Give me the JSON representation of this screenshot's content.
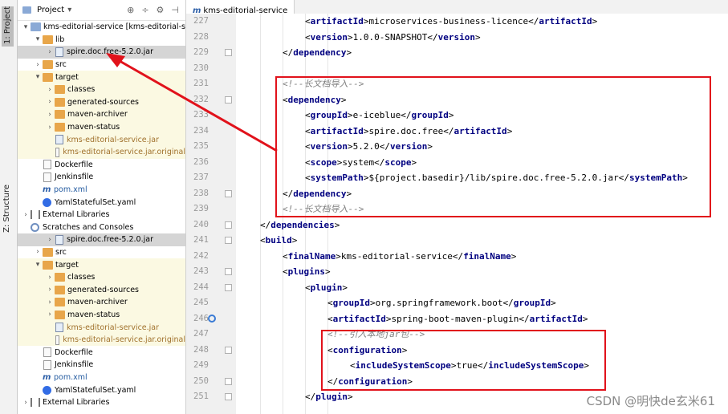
{
  "toolstrip": {
    "project_tab": "1: Project",
    "structure_tab": "Z: Structure"
  },
  "project_panel": {
    "title": "Project",
    "dropdown": "▾",
    "tools": [
      "⊕",
      "÷",
      "⚙",
      "⊣"
    ],
    "tree": [
      {
        "label": "kms-editorial-service [kms-editorial-servi",
        "arrow": "▾",
        "icon": "folder-blue",
        "indent": 0
      },
      {
        "label": "lib",
        "arrow": "▾",
        "icon": "folder",
        "indent": 1
      },
      {
        "label": "spire.doc.free-5.2.0.jar",
        "arrow": "›",
        "icon": "jar",
        "indent": 2,
        "sel": true
      },
      {
        "label": "src",
        "arrow": "›",
        "icon": "folder",
        "indent": 1
      },
      {
        "label": "target",
        "arrow": "▾",
        "icon": "folder",
        "indent": 1,
        "yellow": true
      },
      {
        "label": "classes",
        "arrow": "›",
        "icon": "folder",
        "indent": 2,
        "yellow": true
      },
      {
        "label": "generated-sources",
        "arrow": "›",
        "icon": "folder",
        "indent": 2,
        "yellow": true
      },
      {
        "label": "maven-archiver",
        "arrow": "›",
        "icon": "folder",
        "indent": 2,
        "yellow": true
      },
      {
        "label": "maven-status",
        "arrow": "›",
        "icon": "folder",
        "indent": 2,
        "yellow": true
      },
      {
        "label": "kms-editorial-service.jar",
        "arrow": "",
        "icon": "jar",
        "indent": 2,
        "yellow": true,
        "color": "orange"
      },
      {
        "label": "kms-editorial-service.jar.original",
        "arrow": "",
        "icon": "file",
        "indent": 2,
        "yellow": true,
        "color": "orange"
      },
      {
        "label": "Dockerfile",
        "arrow": "",
        "icon": "file",
        "indent": 1
      },
      {
        "label": "Jenkinsfile",
        "arrow": "",
        "icon": "file",
        "indent": 1
      },
      {
        "label": "pom.xml",
        "arrow": "",
        "icon": "m",
        "indent": 1,
        "color": "blue"
      },
      {
        "label": "YamlStatefulSet.yaml",
        "arrow": "",
        "icon": "k8s",
        "indent": 1
      },
      {
        "label": "External Libraries",
        "arrow": "›",
        "icon": "lib",
        "indent": 0
      },
      {
        "label": "Scratches and Consoles",
        "arrow": "",
        "icon": "scratch",
        "indent": 0
      },
      {
        "label": "spire.doc.free-5.2.0.jar",
        "arrow": "›",
        "icon": "jar",
        "indent": 2,
        "sel": true
      },
      {
        "label": "src",
        "arrow": "›",
        "icon": "folder",
        "indent": 1
      },
      {
        "label": "target",
        "arrow": "▾",
        "icon": "folder",
        "indent": 1,
        "yellow": true
      },
      {
        "label": "classes",
        "arrow": "›",
        "icon": "folder",
        "indent": 2,
        "yellow": true
      },
      {
        "label": "generated-sources",
        "arrow": "›",
        "icon": "folder",
        "indent": 2,
        "yellow": true
      },
      {
        "label": "maven-archiver",
        "arrow": "›",
        "icon": "folder",
        "indent": 2,
        "yellow": true
      },
      {
        "label": "maven-status",
        "arrow": "›",
        "icon": "folder",
        "indent": 2,
        "yellow": true
      },
      {
        "label": "kms-editorial-service.jar",
        "arrow": "",
        "icon": "jar",
        "indent": 2,
        "yellow": true,
        "color": "orange"
      },
      {
        "label": "kms-editorial-service.jar.original",
        "arrow": "",
        "icon": "file",
        "indent": 2,
        "yellow": true,
        "color": "orange"
      },
      {
        "label": "Dockerfile",
        "arrow": "",
        "icon": "file",
        "indent": 1
      },
      {
        "label": "Jenkinsfile",
        "arrow": "",
        "icon": "file",
        "indent": 1
      },
      {
        "label": "pom.xml",
        "arrow": "",
        "icon": "m",
        "indent": 1,
        "color": "blue"
      },
      {
        "label": "YamlStatefulSet.yaml",
        "arrow": "",
        "icon": "k8s",
        "indent": 1
      },
      {
        "label": "External Libraries",
        "arrow": "›",
        "icon": "lib",
        "indent": 0
      }
    ]
  },
  "editor": {
    "tab_icon": "m",
    "tab_label": "kms-editorial-service",
    "lines": [
      {
        "n": "227",
        "indent": 2,
        "parts": [
          [
            "br",
            "<"
          ],
          [
            "tag",
            "artifactId"
          ],
          [
            "br",
            ">microservices-business-licence</"
          ],
          [
            "tag",
            "artifactId"
          ],
          [
            "br",
            ">"
          ]
        ]
      },
      {
        "n": "228",
        "indent": 2,
        "parts": [
          [
            "br",
            "<"
          ],
          [
            "tag",
            "version"
          ],
          [
            "br",
            ">1.0.0-SNAPSHOT</"
          ],
          [
            "tag",
            "version"
          ],
          [
            "br",
            ">"
          ]
        ]
      },
      {
        "n": "229",
        "indent": 1,
        "fold": true,
        "parts": [
          [
            "br",
            "</"
          ],
          [
            "tag",
            "dependency"
          ],
          [
            "br",
            ">"
          ]
        ]
      },
      {
        "n": "230",
        "indent": 0,
        "parts": []
      },
      {
        "n": "231",
        "indent": 1,
        "parts": [
          [
            "cm",
            "<!--长文档导入-->"
          ]
        ]
      },
      {
        "n": "232",
        "indent": 1,
        "fold": true,
        "parts": [
          [
            "br",
            "<"
          ],
          [
            "tag",
            "dependency"
          ],
          [
            "br",
            ">"
          ]
        ]
      },
      {
        "n": "233",
        "indent": 2,
        "parts": [
          [
            "br",
            "<"
          ],
          [
            "tag",
            "groupId"
          ],
          [
            "br",
            ">e-iceblue</"
          ],
          [
            "tag",
            "groupId"
          ],
          [
            "br",
            ">"
          ]
        ]
      },
      {
        "n": "234",
        "indent": 2,
        "parts": [
          [
            "br",
            "<"
          ],
          [
            "tag",
            "artifactId"
          ],
          [
            "br",
            ">spire.doc.free</"
          ],
          [
            "tag",
            "artifactId"
          ],
          [
            "br",
            ">"
          ]
        ]
      },
      {
        "n": "235",
        "indent": 2,
        "parts": [
          [
            "br",
            "<"
          ],
          [
            "tag",
            "version"
          ],
          [
            "br",
            ">5.2.0</"
          ],
          [
            "tag",
            "version"
          ],
          [
            "br",
            ">"
          ]
        ]
      },
      {
        "n": "236",
        "indent": 2,
        "parts": [
          [
            "br",
            "<"
          ],
          [
            "tag",
            "scope"
          ],
          [
            "br",
            ">system</"
          ],
          [
            "tag",
            "scope"
          ],
          [
            "br",
            ">"
          ]
        ]
      },
      {
        "n": "237",
        "indent": 2,
        "parts": [
          [
            "br",
            "<"
          ],
          [
            "tag",
            "systemPath"
          ],
          [
            "br",
            ">${project.basedir}/lib/spire.doc.free-5.2.0.jar</"
          ],
          [
            "tag",
            "systemPath"
          ],
          [
            "br",
            ">"
          ]
        ]
      },
      {
        "n": "238",
        "indent": 1,
        "fold": true,
        "parts": [
          [
            "br",
            "</"
          ],
          [
            "tag",
            "dependency"
          ],
          [
            "br",
            ">"
          ]
        ]
      },
      {
        "n": "239",
        "indent": 1,
        "parts": [
          [
            "cm",
            "<!--长文档导入-->"
          ]
        ]
      },
      {
        "n": "240",
        "indent": 0,
        "fold": true,
        "parts": [
          [
            "br",
            "</"
          ],
          [
            "tag",
            "dependencies"
          ],
          [
            "br",
            ">"
          ]
        ]
      },
      {
        "n": "241",
        "indent": 0,
        "fold": true,
        "parts": [
          [
            "br",
            "<"
          ],
          [
            "tag",
            "build"
          ],
          [
            "br",
            ">"
          ]
        ]
      },
      {
        "n": "242",
        "indent": 1,
        "parts": [
          [
            "br",
            "<"
          ],
          [
            "tag",
            "finalName"
          ],
          [
            "br",
            ">kms-editorial-service</"
          ],
          [
            "tag",
            "finalName"
          ],
          [
            "br",
            ">"
          ]
        ]
      },
      {
        "n": "243",
        "indent": 1,
        "fold": true,
        "parts": [
          [
            "br",
            "<"
          ],
          [
            "tag",
            "plugins"
          ],
          [
            "br",
            ">"
          ]
        ]
      },
      {
        "n": "244",
        "indent": 2,
        "fold": true,
        "parts": [
          [
            "br",
            "<"
          ],
          [
            "tag",
            "plugin"
          ],
          [
            "br",
            ">"
          ]
        ]
      },
      {
        "n": "245",
        "indent": 3,
        "parts": [
          [
            "br",
            "<"
          ],
          [
            "tag",
            "groupId"
          ],
          [
            "br",
            ">org.springframework.boot</"
          ],
          [
            "tag",
            "groupId"
          ],
          [
            "br",
            ">"
          ]
        ]
      },
      {
        "n": "246",
        "indent": 3,
        "gicon": true,
        "parts": [
          [
            "br",
            "<"
          ],
          [
            "tag",
            "artifactId"
          ],
          [
            "br",
            ">spring-boot-maven-plugin</"
          ],
          [
            "tag",
            "artifactId"
          ],
          [
            "br",
            ">"
          ]
        ]
      },
      {
        "n": "247",
        "indent": 3,
        "parts": [
          [
            "cm",
            "<!--引入本地jar包-->"
          ]
        ]
      },
      {
        "n": "248",
        "indent": 3,
        "fold": true,
        "parts": [
          [
            "br",
            "<"
          ],
          [
            "tag",
            "configuration"
          ],
          [
            "br",
            ">"
          ]
        ]
      },
      {
        "n": "249",
        "indent": 4,
        "parts": [
          [
            "br",
            "<"
          ],
          [
            "tag",
            "includeSystemScope"
          ],
          [
            "br",
            ">true</"
          ],
          [
            "tag",
            "includeSystemScope"
          ],
          [
            "br",
            ">"
          ]
        ]
      },
      {
        "n": "250",
        "indent": 3,
        "fold": true,
        "parts": [
          [
            "br",
            "</"
          ],
          [
            "tag",
            "configuration"
          ],
          [
            "br",
            ">"
          ]
        ]
      },
      {
        "n": "251",
        "indent": 2,
        "fold": true,
        "parts": [
          [
            "br",
            "</"
          ],
          [
            "tag",
            "plugin"
          ],
          [
            "br",
            ">"
          ]
        ]
      }
    ]
  },
  "annotation": {
    "color": "#e1121b"
  },
  "watermark": "CSDN @明快de玄米61"
}
